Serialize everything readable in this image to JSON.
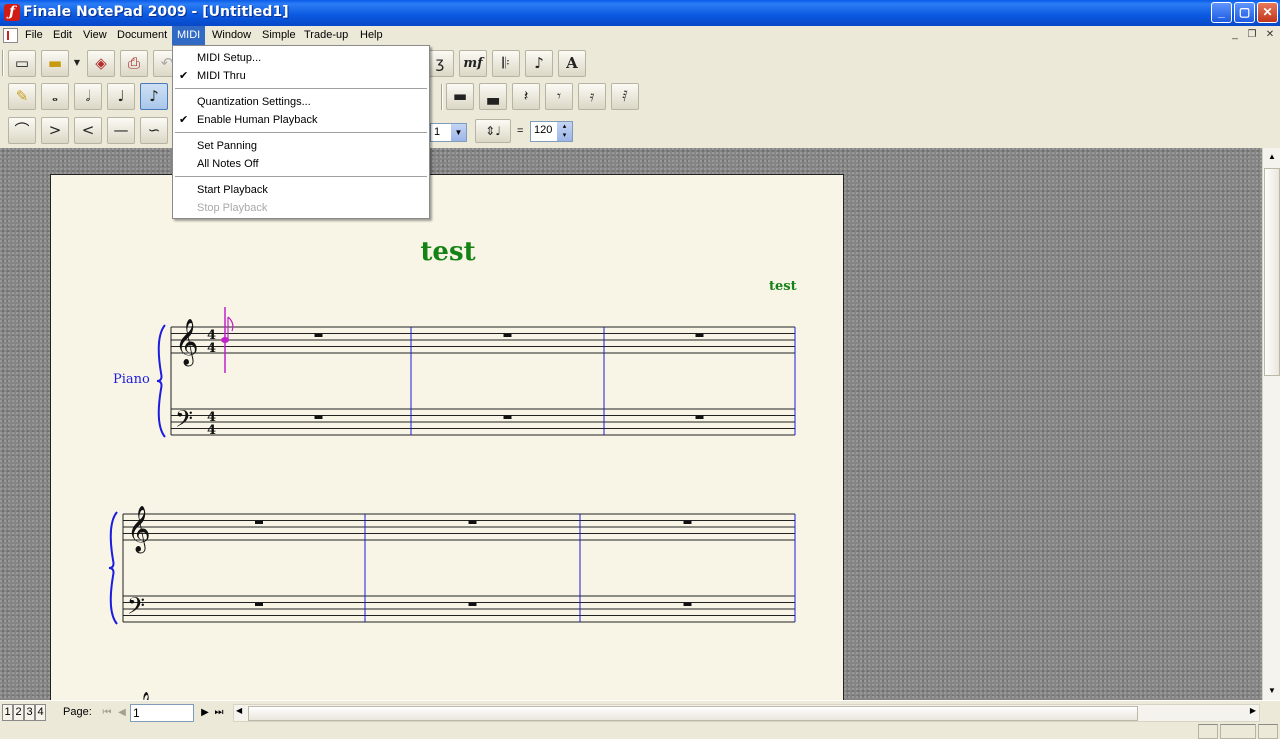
{
  "window": {
    "title": "Finale NotePad 2009 - [Untitled1]",
    "controls": {
      "minimize": "_",
      "maximize": "▢",
      "close": "✕"
    }
  },
  "menubar": {
    "items": [
      "File",
      "Edit",
      "View",
      "Document",
      "MIDI",
      "Window",
      "Simple",
      "Trade-up",
      "Help"
    ],
    "active": "MIDI"
  },
  "midi_menu": {
    "items": [
      {
        "label": "MIDI Setup...",
        "checked": false,
        "enabled": true
      },
      {
        "label": "MIDI Thru",
        "checked": true,
        "enabled": true
      },
      {
        "label": "Quantization Settings...",
        "checked": false,
        "enabled": true
      },
      {
        "label": "Enable Human Playback",
        "checked": true,
        "enabled": true
      },
      {
        "label": "Set Panning",
        "checked": false,
        "enabled": true
      },
      {
        "label": "All Notes Off",
        "checked": false,
        "enabled": true
      },
      {
        "label": "Start Playback",
        "checked": false,
        "enabled": true
      },
      {
        "label": "Stop Playback",
        "checked": false,
        "enabled": false
      }
    ]
  },
  "toolbar": {
    "measure_value": "1",
    "tempo_equals": "=",
    "tempo_value": "120",
    "expression_text": "mf",
    "text_tool": "A"
  },
  "score": {
    "title": "test",
    "composer": "test",
    "instrument": "Piano",
    "time_signature": "4/4"
  },
  "status": {
    "page_tabs": [
      "1",
      "2",
      "3",
      "4"
    ],
    "page_label": "Page:",
    "page_value": "1"
  },
  "colors": {
    "title_text": "#148214",
    "instrument_text": "#1c1ce0",
    "barline": "#1c1ce0",
    "cursor": "#c020c8",
    "menu_highlight": "#316ac5"
  }
}
